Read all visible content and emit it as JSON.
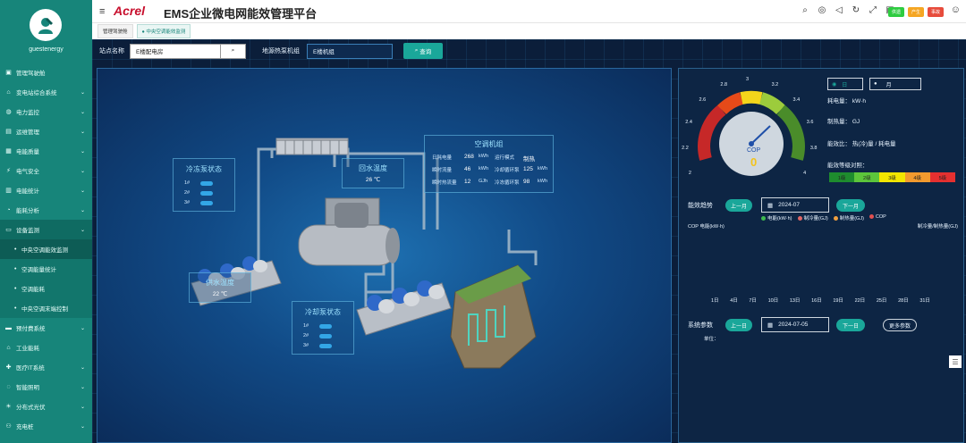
{
  "app": {
    "logo": "Acrel",
    "title": "EMS企业微电网能效管理平台",
    "username": "guestenergy"
  },
  "header": {
    "pills": [
      {
        "label": "供遗",
        "color": "#2ecc40"
      },
      {
        "label": "产生",
        "color": "#f5a623"
      },
      {
        "label": "事故",
        "color": "#e74c3c"
      }
    ]
  },
  "sidebar": {
    "items": [
      {
        "label": "管理驾驶舱",
        "icon": "dashboard-icon",
        "chevron": false
      },
      {
        "label": "变电站综合系统",
        "icon": "home-icon",
        "chevron": true
      },
      {
        "label": "电力监控",
        "icon": "globe-icon",
        "chevron": true
      },
      {
        "label": "运维管理",
        "icon": "clipboard-icon",
        "chevron": true
      },
      {
        "label": "电能质量",
        "icon": "grid-icon",
        "chevron": true
      },
      {
        "label": "电气安全",
        "icon": "bolt-icon",
        "chevron": true
      },
      {
        "label": "电能统计",
        "icon": "bar-chart-icon",
        "chevron": true
      },
      {
        "label": "能耗分析",
        "icon": "analysis-icon",
        "chevron": true
      },
      {
        "label": "设备监测",
        "icon": "monitor-icon",
        "chevron": true,
        "active": true
      }
    ],
    "sub_items": [
      {
        "label": "中央空调能效监测",
        "active": true
      },
      {
        "label": "空调能量统计",
        "active": false
      },
      {
        "label": "空调能耗",
        "active": false
      },
      {
        "label": "中央空调末端控制",
        "active": false
      }
    ],
    "items_after": [
      {
        "label": "预付费系统",
        "icon": "card-icon",
        "chevron": true
      },
      {
        "label": "工业能耗",
        "icon": "factory-icon",
        "chevron": false
      },
      {
        "label": "医疗IT系统",
        "icon": "medical-icon",
        "chevron": true
      },
      {
        "label": "智能照明",
        "icon": "bulb-icon",
        "chevron": true
      },
      {
        "label": "分布式光伏",
        "icon": "solar-icon",
        "chevron": true
      },
      {
        "label": "充电桩",
        "icon": "charger-icon",
        "chevron": true
      }
    ]
  },
  "tabs": [
    {
      "label": "管理驾驶舱",
      "active": false
    },
    {
      "label": "中央空调能效监测",
      "active": true
    }
  ],
  "filter": {
    "station_label": "站点名称",
    "station_value": "E楼配电房",
    "group_label": "地源热泵机组",
    "group_value": "E楼机组",
    "query_label": "查询"
  },
  "scene": {
    "chiller_panel": {
      "title": "空调机组",
      "rows": [
        {
          "k1": "日耗电量",
          "v1": "268",
          "u1": "kWh",
          "k2": "运行模式",
          "v2": "制热"
        },
        {
          "k1": "瞬时流量",
          "v1": "46",
          "u1": "kWh",
          "k2": "冷却循环泵",
          "v2": "125",
          "u2": "kWh"
        },
        {
          "k1": "瞬时热流量",
          "v1": "12",
          "u1": "GJh",
          "k2": "冷冻循环泵",
          "v2": "98",
          "u2": "kWh"
        }
      ]
    },
    "freeze_pump": {
      "title": "冷冻泵状态",
      "rows": [
        "1#",
        "2#",
        "3#"
      ]
    },
    "cool_pump": {
      "title": "冷却泵状态",
      "rows": [
        "1#",
        "2#",
        "3#"
      ]
    },
    "return_temp": {
      "title": "回水温度",
      "value": "26 ℃"
    },
    "supply_temp": {
      "title": "供水温度",
      "value": "22 ℃"
    }
  },
  "gauge": {
    "label": "COP",
    "value": "0",
    "ticks": [
      "2",
      "2.2",
      "2.4",
      "2.6",
      "2.8",
      "3",
      "3.2",
      "3.4",
      "3.6",
      "3.8",
      "4"
    ]
  },
  "info": {
    "radio_day": "日",
    "radio_month": "月",
    "power_label": "耗电量：",
    "power_unit": "kW·h",
    "heat_label": "制热量：",
    "heat_unit": "GJ",
    "ratio_label": "能效比：",
    "ratio_value": "热(冷)量 / 耗电量",
    "level_label": "能效等级对照：",
    "levels": [
      {
        "label": "1级",
        "color": "#1e8c2e"
      },
      {
        "label": "2级",
        "color": "#5cc53b"
      },
      {
        "label": "3级",
        "color": "#f2e600"
      },
      {
        "label": "4级",
        "color": "#f29a2e"
      },
      {
        "label": "5级",
        "color": "#e53030"
      }
    ]
  },
  "trend": {
    "label": "能效趋势",
    "prev": "上一月",
    "date": "2024-07",
    "next": "下一月",
    "left_axis": "COP 电能(kW·h)",
    "right_axis": "制冷量/制热量(GJ)",
    "legend": [
      {
        "label": "电能(kW·h)",
        "color": "#3fb950"
      },
      {
        "label": "制冷量(GJ)",
        "color": "#e06666"
      },
      {
        "label": "制热量(GJ)",
        "color": "#f0a040"
      },
      {
        "label": "COP",
        "color": "#e05050"
      }
    ],
    "days": [
      "1日",
      "4日",
      "7日",
      "10日",
      "13日",
      "16日",
      "19日",
      "22日",
      "25日",
      "28日",
      "31日"
    ]
  },
  "params": {
    "label": "系统参数",
    "prev": "上一日",
    "date": "2024-07-05",
    "next": "下一日",
    "more": "更多参数",
    "unit_label": "单位："
  }
}
